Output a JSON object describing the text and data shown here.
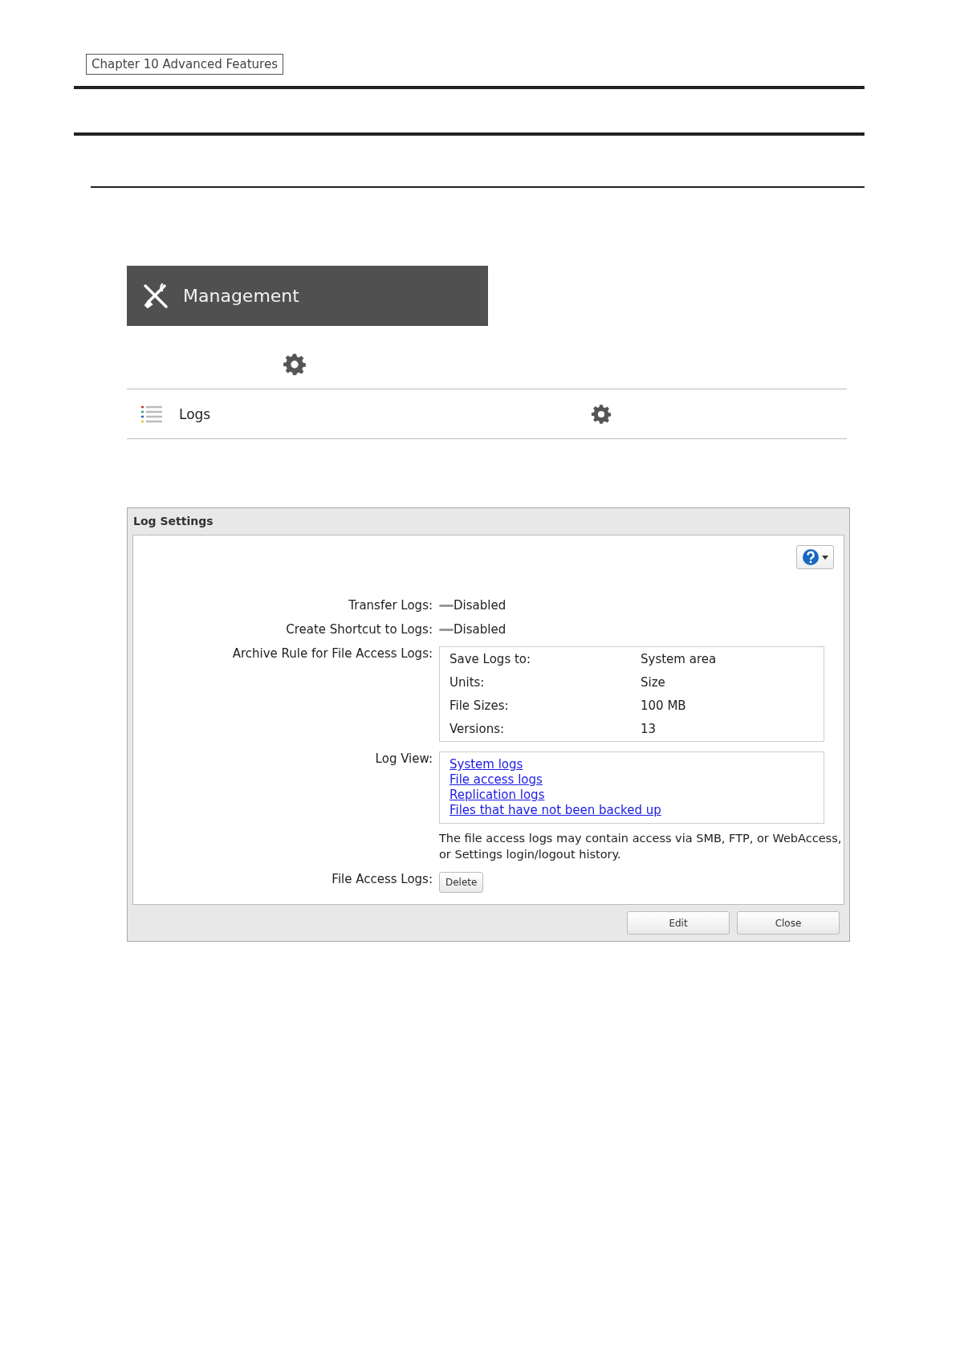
{
  "header": {
    "chapter": "Chapter 10 Advanced Features"
  },
  "menu_banner": {
    "title": "Management"
  },
  "list_row": {
    "label": "Logs"
  },
  "dialog": {
    "title": "Log Settings",
    "rows": [
      {
        "kind": "status",
        "label": "Transfer Logs:",
        "on": false,
        "value": "Disabled"
      },
      {
        "kind": "status",
        "label": "Create Shortcut to Logs:",
        "on": false,
        "value": "Disabled"
      },
      {
        "kind": "table",
        "label": "Archive Rule for File Access Logs:",
        "pairs": [
          {
            "key": "Save Logs to:",
            "value": "System area"
          },
          {
            "key": "Units:",
            "value": "Size"
          },
          {
            "key": "File Sizes:",
            "value": "100 MB"
          },
          {
            "key": "Versions:",
            "value": "13"
          }
        ]
      },
      {
        "kind": "links",
        "label": "Log View:",
        "links": [
          "System logs",
          "File access logs",
          "Replication logs",
          "Files that have not been backed up"
        ],
        "note": "The file access logs may contain access via SMB, FTP, or WebAccess, or Settings login/logout history."
      },
      {
        "kind": "button",
        "label": "File Access Logs:",
        "button": "Delete"
      }
    ],
    "buttons": [
      "Edit",
      "Close"
    ]
  }
}
